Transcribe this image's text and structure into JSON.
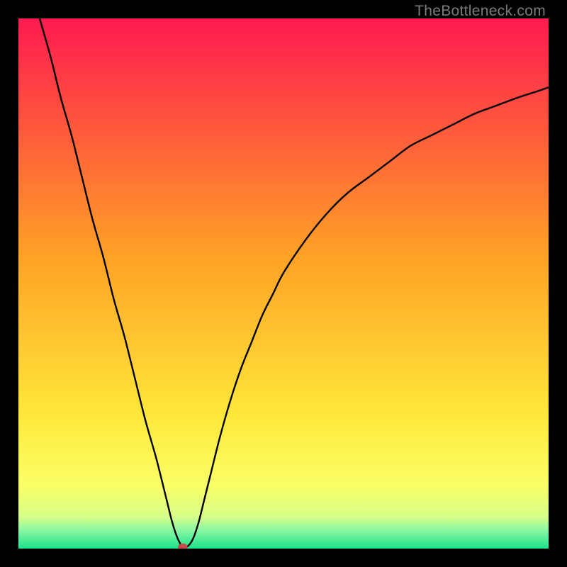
{
  "watermark": "TheBottleneck.com",
  "chart_data": {
    "type": "line",
    "title": "",
    "xlabel": "",
    "ylabel": "",
    "xlim": [
      0,
      100
    ],
    "ylim": [
      0,
      100
    ],
    "grid": false,
    "legend": false,
    "series": [
      {
        "name": "curve",
        "x": [
          4,
          6,
          8,
          10,
          12,
          14,
          16,
          18,
          20,
          22,
          24,
          26,
          28,
          29,
          30,
          31,
          32,
          33,
          34,
          35,
          36,
          38,
          40,
          42,
          44,
          46,
          48,
          50,
          54,
          58,
          62,
          66,
          70,
          74,
          78,
          82,
          86,
          90,
          94,
          98,
          100
        ],
        "y": [
          100,
          93,
          85,
          78,
          70,
          62,
          55,
          47,
          40,
          32,
          24,
          17,
          9,
          5,
          2,
          0.3,
          0.5,
          2,
          5,
          9,
          13,
          21,
          28,
          34,
          39,
          44,
          48,
          52,
          58,
          63,
          67,
          70,
          73,
          76,
          78,
          80,
          82,
          83.5,
          85,
          86.3,
          87
        ]
      }
    ],
    "marker": {
      "x": 31,
      "y": 0.3,
      "color": "#c94a4a",
      "radius_pct": 0.9
    },
    "background_gradient": [
      {
        "stop": 0.0,
        "color": "#ff1a4f"
      },
      {
        "stop": 0.45,
        "color": "#ffa226"
      },
      {
        "stop": 0.75,
        "color": "#ffe83a"
      },
      {
        "stop": 0.88,
        "color": "#faff66"
      },
      {
        "stop": 0.94,
        "color": "#d7ff88"
      },
      {
        "stop": 0.965,
        "color": "#8cf7a4"
      },
      {
        "stop": 1.0,
        "color": "#19e38b"
      }
    ]
  }
}
